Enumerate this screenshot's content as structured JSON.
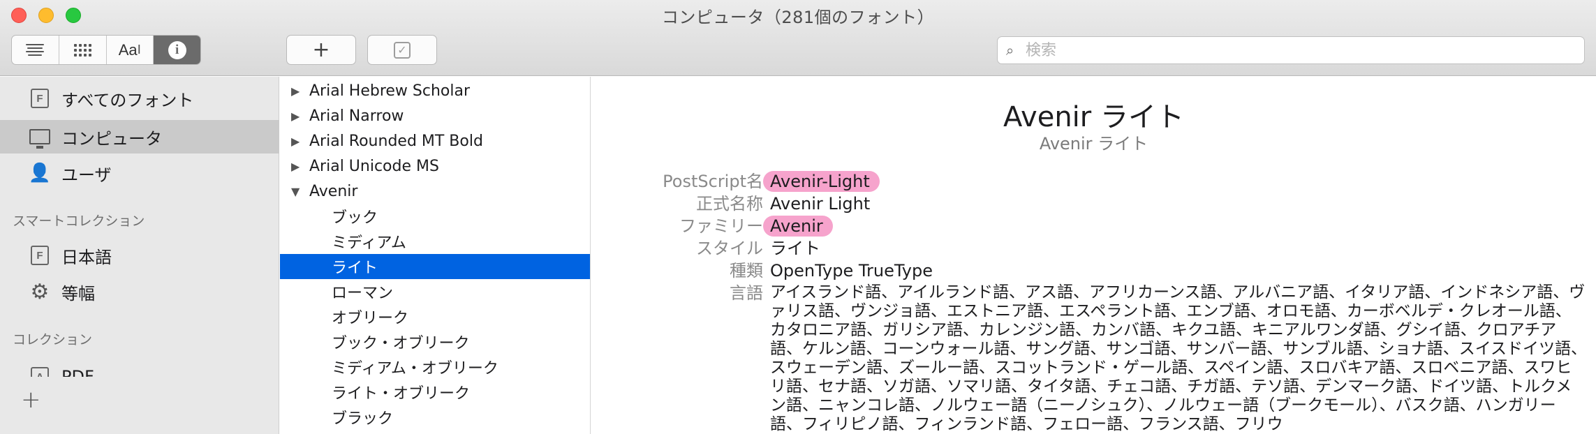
{
  "window": {
    "title": "コンピュータ（281個のフォント）"
  },
  "toolbar": {
    "view_buttons": [
      {
        "name": "list-view-icon"
      },
      {
        "name": "grid-view-icon"
      },
      {
        "name": "sample-view-icon",
        "label": "Aa"
      },
      {
        "name": "info-view-icon",
        "label": "i"
      }
    ],
    "add_label": "+",
    "validate_label": "✓",
    "search_placeholder": "検索"
  },
  "sidebar": {
    "items": [
      {
        "label": "すべてのフォント",
        "icon": "font-file-icon"
      },
      {
        "label": "コンピュータ",
        "icon": "monitor-icon",
        "selected": true
      },
      {
        "label": "ユーザ",
        "icon": "user-icon"
      }
    ],
    "smart_header": "スマートコレクション",
    "smart_items": [
      {
        "label": "日本語",
        "icon": "font-file-icon"
      },
      {
        "label": "等幅",
        "icon": "gear-icon"
      }
    ],
    "collection_header": "コレクション",
    "collection_items": [
      {
        "label": "PDF",
        "icon": "font-file-icon"
      }
    ],
    "add_label": "+"
  },
  "font_list": {
    "families": [
      {
        "label": "Arial Hebrew Scholar",
        "expanded": false
      },
      {
        "label": "Arial Narrow",
        "expanded": false
      },
      {
        "label": "Arial Rounded MT Bold",
        "expanded": false
      },
      {
        "label": "Arial Unicode MS",
        "expanded": false
      },
      {
        "label": "Avenir",
        "expanded": true
      }
    ],
    "faces": [
      "ブック",
      "ミディアム",
      "ライト",
      "ローマン",
      "オブリーク",
      "ブック・オブリーク",
      "ミディアム・オブリーク",
      "ライト・オブリーク",
      "ブラック"
    ],
    "selected_face": "ライト"
  },
  "detail": {
    "title": "Avenir ライト",
    "subtitle": "Avenir ライト",
    "rows": [
      {
        "key": "PostScript名",
        "value": "Avenir-Light",
        "highlight": true
      },
      {
        "key": "正式名称",
        "value": "Avenir Light",
        "highlight": false
      },
      {
        "key": "ファミリー",
        "value": "Avenir",
        "highlight": true
      },
      {
        "key": "スタイル",
        "value": "ライト",
        "highlight": false
      },
      {
        "key": "種類",
        "value": "OpenType TrueType",
        "highlight": false
      }
    ],
    "language_key": "言語",
    "languages": "アイスランド語、アイルランド語、アス語、アフリカーンス語、アルバニア語、イタリア語、インドネシア語、ヴァリス語、ヴンジョ語、エストニア語、エスペラント語、エンブ語、オロモ語、カーボベルデ・クレオール語、カタロニア語、ガリシア語、カレンジン語、カンバ語、キクユ語、キニアルワンダ語、グシイ語、クロアチア語、ケルン語、コーンウォール語、サング語、サンゴ語、サンバー語、サンブル語、ショナ語、スイスドイツ語、スウェーデン語、ズールー語、スコットランド・ゲール語、スペイン語、スロバキア語、スロベニア語、スワヒリ語、セナ語、ソガ語、ソマリ語、タイタ語、チェコ語、チガ語、テソ語、デンマーク語、ドイツ語、トルクメン語、ニャンコレ語、ノルウェー語（ニーノシュク）、ノルウェー語（ブークモール）、バスク語、ハンガリー語、フィリピノ語、フィンランド語、フェロー語、フランス語、フリウ"
  },
  "colors": {
    "selection": "#0063e1",
    "highlight": "#f6a3cc",
    "sidebar_bg": "#e8e8e8"
  }
}
